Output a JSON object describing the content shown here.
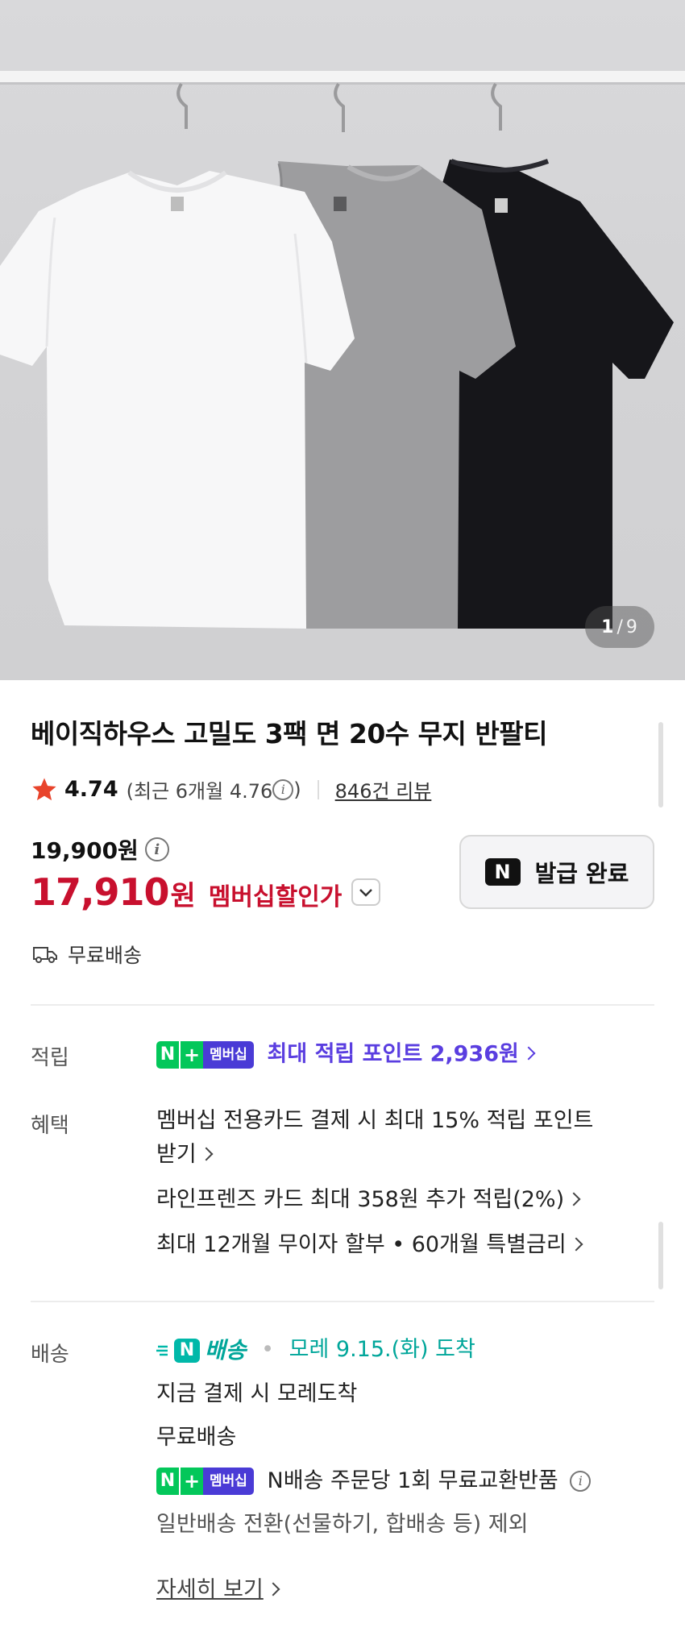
{
  "gallery": {
    "current": "1",
    "separator": "/",
    "total": "9"
  },
  "product": {
    "title": "베이직하우스 고밀도 3팩 면 20수 무지 반팔티",
    "rating": "4.74",
    "recent_rating": "(최근 6개월 4.76",
    "recent_close": ")",
    "reviews": "846건 리뷰",
    "original_price": "19,900원",
    "sale_price": "17,910",
    "sale_currency": "원",
    "sale_label": "멤버십할인가",
    "coupon_badge": "N",
    "coupon_label": "발급 완료",
    "free_shipping": "무료배송"
  },
  "points_row": {
    "label": "적립",
    "badge_n": "N",
    "badge_plus": "+",
    "badge_membership": "멤버십",
    "text": "최대 적립 포인트 2,936원"
  },
  "benefit_row": {
    "label": "혜택",
    "line1": "멤버십 전용카드 결제 시 최대 15% 적립 포인트",
    "line1b": "받기",
    "line2": "라인프렌즈 카드 최대 358원 추가 적립(2%)",
    "line3": "최대 12개월 무이자 할부 • 60개월 특별금리"
  },
  "delivery_row": {
    "label": "배송",
    "nship_icon": "N",
    "nship_text": "배송",
    "arrival": "모레 9.15.(화) 도착",
    "line2": "지금 결제 시 모레도착",
    "line3": "무료배송",
    "badge_n": "N",
    "badge_plus": "+",
    "badge_membership": "멤버십",
    "line4": "N배송 주문당 1회 무료교환반품",
    "line5": "일반배송 전환(선물하기, 합배송 등) 제외",
    "detail_link": "자세히 보기"
  },
  "colors": {
    "sale_red": "#c8102e",
    "naver_green": "#03c75a",
    "membership_purple": "#4a3bd6",
    "points_purple": "#5a3ee0",
    "nship_teal": "#00a69a"
  }
}
